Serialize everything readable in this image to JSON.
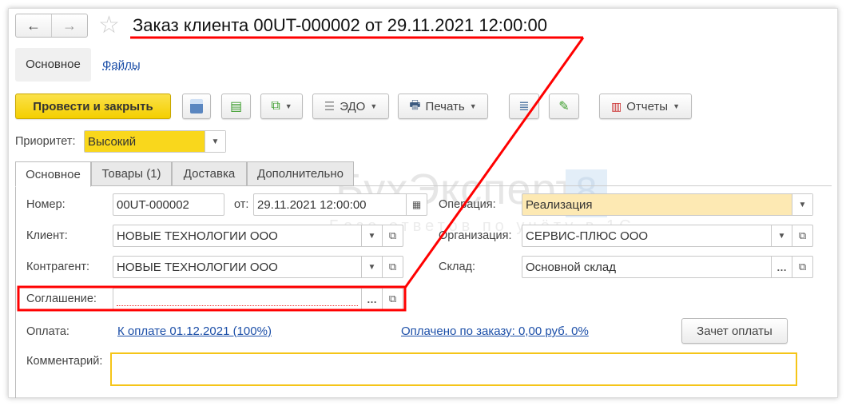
{
  "header": {
    "title": "Заказ клиента 00UT-000002 от 29.11.2021 12:00:00",
    "back": "←",
    "forward": "→"
  },
  "nav": {
    "main": "Основное",
    "files": "Файлы"
  },
  "toolbar": {
    "post_close": "Провести и закрыть",
    "edo": "ЭДО",
    "print": "Печать",
    "reports": "Отчеты"
  },
  "priority": {
    "label": "Приоритет:",
    "value": "Высокий"
  },
  "tabs": [
    {
      "label": "Основное"
    },
    {
      "label": "Товары (1)"
    },
    {
      "label": "Доставка"
    },
    {
      "label": "Дополнительно"
    }
  ],
  "form": {
    "number_label": "Номер:",
    "number": "00UT-000002",
    "date_label": "от:",
    "date": "29.11.2021 12:00:00",
    "client_label": "Клиент:",
    "client": "НОВЫЕ ТЕХНОЛОГИИ ООО",
    "counterparty_label": "Контрагент:",
    "counterparty": "НОВЫЕ ТЕХНОЛОГИИ ООО",
    "agreement_label": "Соглашение:",
    "agreement": "",
    "operation_label": "Операция:",
    "operation": "Реализация",
    "org_label": "Организация:",
    "org": "СЕРВИС-ПЛЮС ООО",
    "warehouse_label": "Склад:",
    "warehouse": "Основной склад",
    "payment_label": "Оплата:",
    "payment_link": "К оплате 01.12.2021 (100%)",
    "paid_link": "Оплачено по заказу: 0,00 руб. 0%",
    "offset_button": "Зачет оплаты",
    "comment_label": "Комментарий:",
    "comment": ""
  },
  "watermark": {
    "brand": "БухЭксперт",
    "num": "8",
    "sub": "База ответов по учёту в 1С"
  },
  "colors": {
    "accent_yellow": "#f9d71c",
    "annotation": "#ff0000",
    "operation_bg": "#fde9b3",
    "link": "#1c4fa8"
  }
}
